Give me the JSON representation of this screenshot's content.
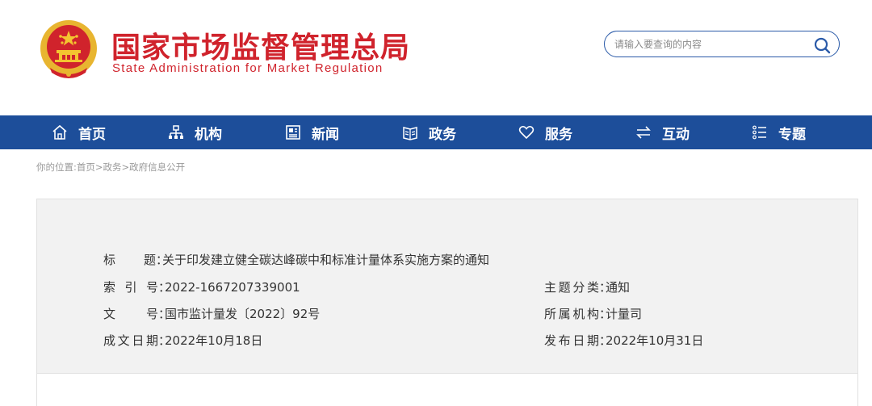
{
  "header": {
    "title_cn": "国家市场监督管理总局",
    "title_en": "State Administration for Market Regulation",
    "search": {
      "placeholder": "请输入要查询的内容"
    }
  },
  "nav": {
    "items": [
      {
        "label": "首页",
        "icon": "home-icon"
      },
      {
        "label": "机构",
        "icon": "org-chart-icon"
      },
      {
        "label": "新闻",
        "icon": "newspaper-icon"
      },
      {
        "label": "政务",
        "icon": "book-icon"
      },
      {
        "label": "服务",
        "icon": "heart-icon"
      },
      {
        "label": "互动",
        "icon": "swap-arrows-icon"
      },
      {
        "label": "专题",
        "icon": "list-icon"
      }
    ]
  },
  "breadcrumb": {
    "prefix": "你的位置:",
    "items": [
      "首页",
      "政务",
      "政府信息公开"
    ],
    "separator": ">"
  },
  "meta": {
    "title_label": "标题",
    "title_value": "关于印发建立健全碳达峰碳中和标准计量体系实施方案的通知",
    "index_label": "索引号",
    "index_value": "2022-1667207339001",
    "category_label": "主题分类",
    "category_value": "通知",
    "doc_no_label": "文号",
    "doc_no_value": "国市监计量发〔2022〕92号",
    "org_label": "所属机构",
    "org_value": "计量司",
    "created_label": "成文日期",
    "created_value": "2022年10月18日",
    "published_label": "发布日期",
    "published_value": "2022年10月31日",
    "colon": "："
  },
  "colors": {
    "brand_red": "#d0232c",
    "nav_blue": "#1d4e9a",
    "emblem_gold": "#e8b530"
  }
}
